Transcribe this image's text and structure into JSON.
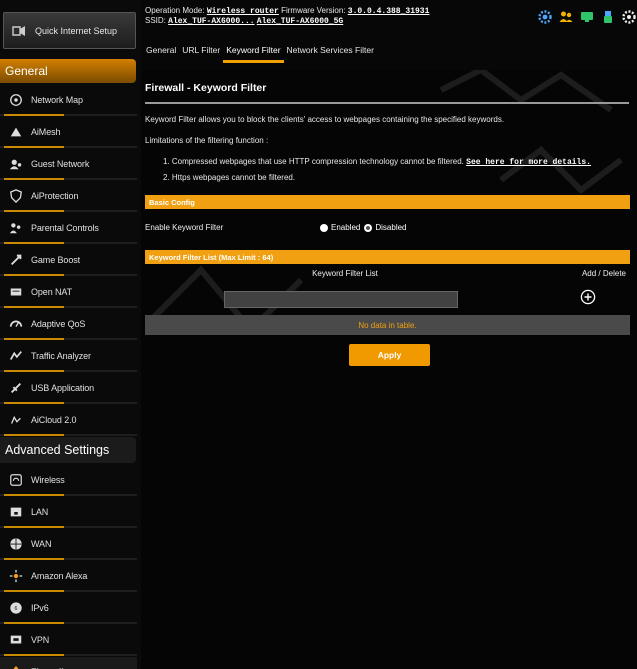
{
  "sidebar": {
    "quick_setup": "Quick Internet Setup",
    "general_title": "General",
    "general_items": [
      {
        "label": "Network Map",
        "icon": "network-map-icon"
      },
      {
        "label": "AiMesh",
        "icon": "aimesh-icon"
      },
      {
        "label": "Guest Network",
        "icon": "guest-network-icon"
      },
      {
        "label": "AiProtection",
        "icon": "aiprotection-icon"
      },
      {
        "label": "Parental Controls",
        "icon": "parental-controls-icon"
      },
      {
        "label": "Game Boost",
        "icon": "game-boost-icon"
      },
      {
        "label": "Open NAT",
        "icon": "open-nat-icon"
      },
      {
        "label": "Adaptive QoS",
        "icon": "adaptive-qos-icon"
      },
      {
        "label": "Traffic Analyzer",
        "icon": "traffic-analyzer-icon"
      },
      {
        "label": "USB Application",
        "icon": "usb-application-icon"
      },
      {
        "label": "AiCloud 2.0",
        "icon": "aicloud-icon"
      }
    ],
    "advanced_title": "Advanced Settings",
    "advanced_items": [
      {
        "label": "Wireless",
        "icon": "wireless-icon"
      },
      {
        "label": "LAN",
        "icon": "lan-icon"
      },
      {
        "label": "WAN",
        "icon": "wan-icon"
      },
      {
        "label": "Amazon Alexa",
        "icon": "alexa-icon"
      },
      {
        "label": "IPv6",
        "icon": "ipv6-icon"
      },
      {
        "label": "VPN",
        "icon": "vpn-icon"
      },
      {
        "label": "Firewall",
        "icon": "firewall-icon"
      }
    ]
  },
  "header": {
    "op_mode_label": "Operation Mode:",
    "op_mode_value": "Wireless router",
    "fw_label": "Firmware Version:",
    "fw_value": "3.0.0.4.388_31931",
    "ssid_label": "SSID:",
    "ssid_1": "Alex_TUF-AX6000...",
    "ssid_2": "Alex_TUF-AX6000_5G",
    "tabs": [
      "General",
      "URL Filter",
      "Keyword Filter",
      "Network Services Filter"
    ],
    "active_tab": "Keyword Filter"
  },
  "main": {
    "title": "Firewall - Keyword Filter",
    "description": "Keyword Filter allows you to block the clients' access to webpages containing the specified keywords.",
    "limitations": "Limitations of the filtering function :",
    "limit_1": "1. Compressed webpages that use HTTP compression technology cannot be filtered.",
    "limit_1_link": "See here for more details.",
    "limit_2": "2. Https webpages cannot be filtered.",
    "basic_config_title": "Basic Config",
    "enable_label": "Enable Keyword Filter",
    "enabled_label": "Enabled",
    "disabled_label": "Disabled",
    "selected": "Disabled",
    "list_title": "Keyword Filter List (Max Limit : 64)",
    "col_list": "Keyword Filter List",
    "col_add": "Add / Delete",
    "keyword_value": "",
    "no_data": "No data in table.",
    "apply_label": "Apply"
  },
  "colors": {
    "accent": "#f0a010",
    "background": "#050505",
    "nodata_text": "#f0a010"
  }
}
